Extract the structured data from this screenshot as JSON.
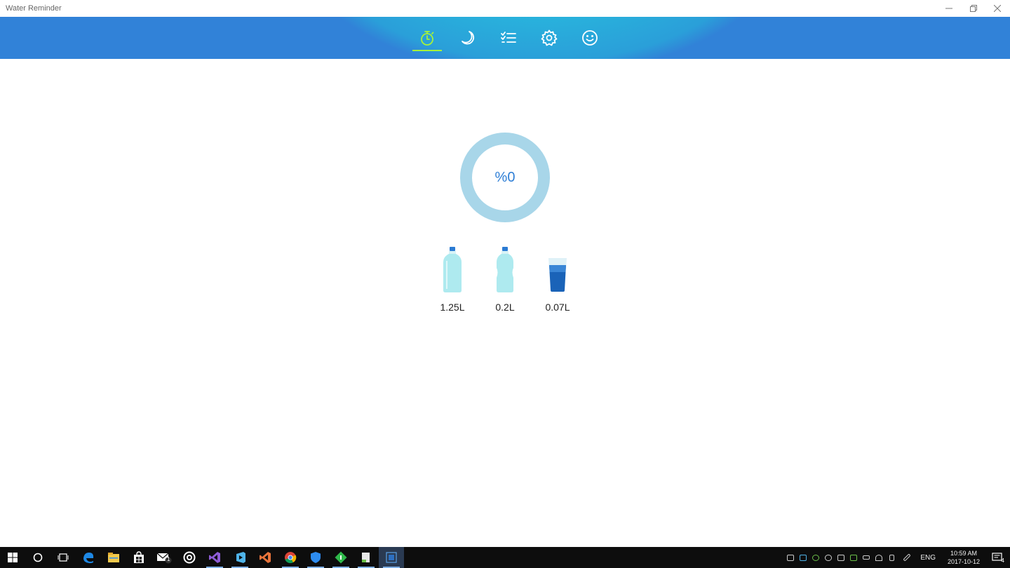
{
  "window": {
    "title": "Water Reminder"
  },
  "header": {
    "colors": {
      "bar": "#3182d8",
      "active": "#a6f23b"
    }
  },
  "nav": [
    {
      "id": "timer",
      "icon": "stopwatch-icon",
      "active": true
    },
    {
      "id": "sleep",
      "icon": "moon-icon",
      "active": false
    },
    {
      "id": "history",
      "icon": "checklist-icon",
      "active": false
    },
    {
      "id": "settings",
      "icon": "gear-icon",
      "active": false
    },
    {
      "id": "about",
      "icon": "smiley-icon",
      "active": false
    }
  ],
  "progress": {
    "label": "%0",
    "percent": 0,
    "ring_color": "#a8d6e9"
  },
  "drinks": [
    {
      "icon": "large-bottle-icon",
      "amount": "1.25L"
    },
    {
      "icon": "small-bottle-icon",
      "amount": "0.2L"
    },
    {
      "icon": "glass-icon",
      "amount": "0.07L"
    }
  ],
  "taskbar": {
    "apps": [
      "start-icon",
      "cortana-icon",
      "task-view-icon",
      "edge-icon",
      "file-explorer-icon",
      "store-icon",
      "mail-icon",
      "groove-icon",
      "visual-studio-icon",
      "visual-studio-code-icon",
      "vs-icon",
      "chrome-icon",
      "defender-icon",
      "app-green-icon",
      "app-notepad-icon",
      "water-reminder-icon"
    ],
    "mail_badge": "1",
    "language": "ENG",
    "time": "10:59 AM",
    "date": "2017-10-12",
    "notifications": "4"
  }
}
